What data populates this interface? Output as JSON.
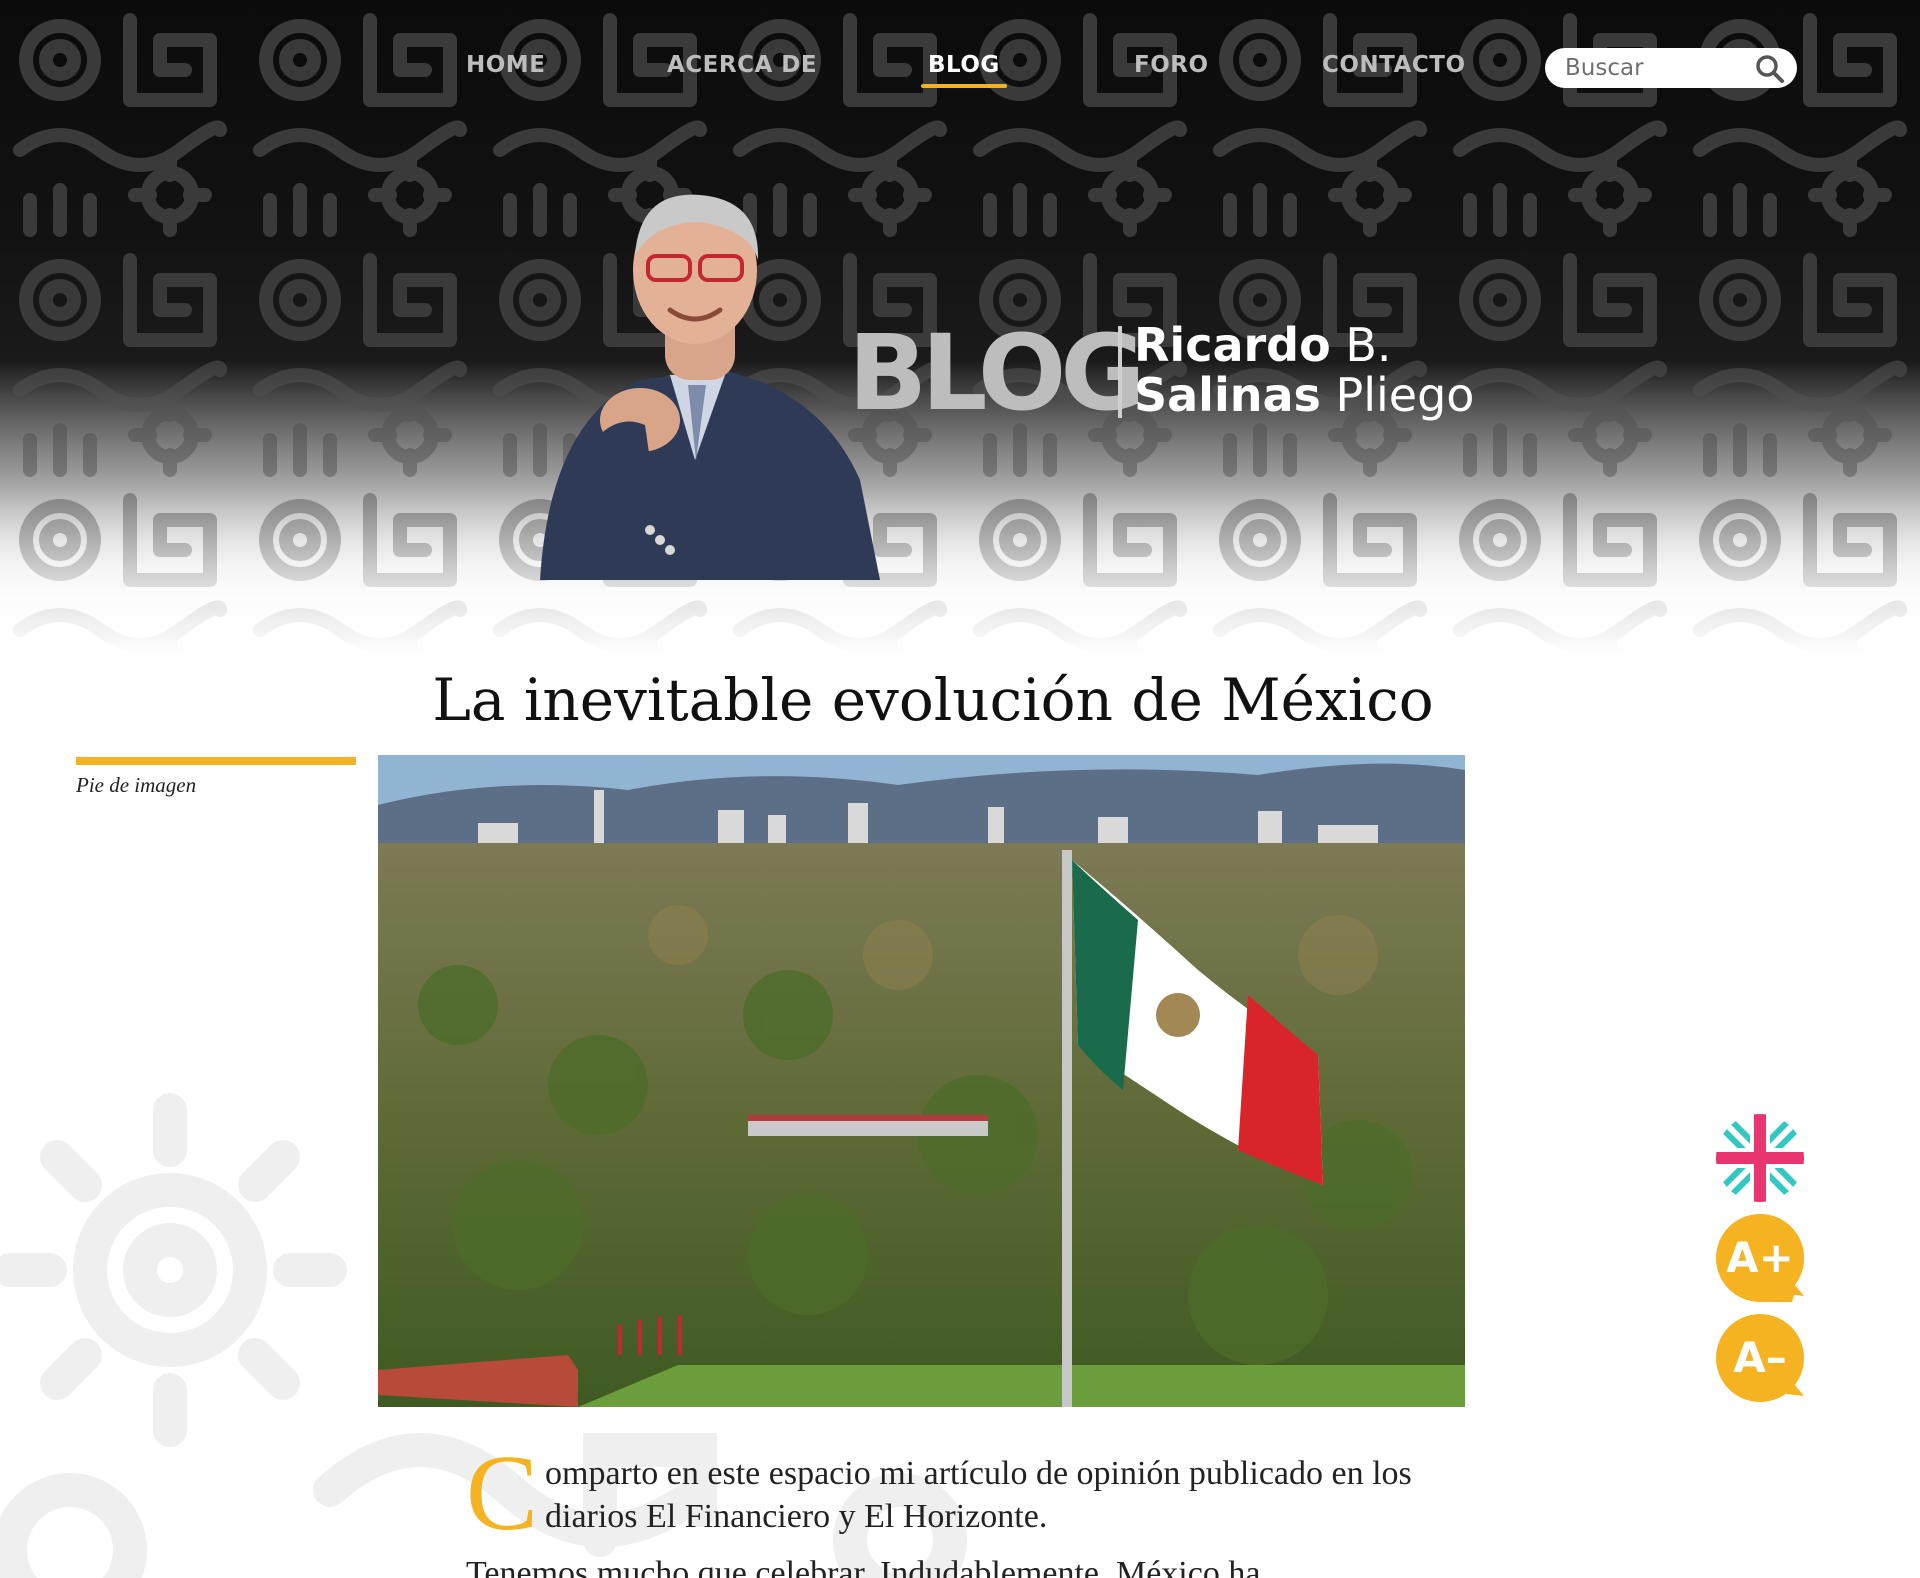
{
  "nav": {
    "items": [
      {
        "label": "HOME"
      },
      {
        "label": "ACERCA DE"
      },
      {
        "label": "BLOG"
      },
      {
        "label": "FORO"
      },
      {
        "label": "CONTACTO"
      }
    ],
    "active": "BLOG",
    "search_placeholder": "Buscar"
  },
  "logo": {
    "blog": "BLOG",
    "name_bold_1": "Ricardo",
    "name_light_1": " B.",
    "name_bold_2": "Salinas",
    "name_light_2": " Pliego"
  },
  "article": {
    "title": "La inevitable evolución de México",
    "caption": "Pie de imagen",
    "drop_cap": "C",
    "intro": "omparto en este espacio mi artículo de opinión publicado en los diarios El Financiero y El Horizonte.",
    "second_paragraph": "Tenemos mucho que celebrar. Indudablemente, México ha"
  },
  "floating_buttons": {
    "language": "uk-flag-icon",
    "increase_font": "A+",
    "decrease_font": "A–"
  },
  "colors": {
    "accent": "#f5b321",
    "hero_bg": "#0b0b0b",
    "nav_text": "#bdbdbd",
    "nav_active": "#ffffff",
    "flag_pink": "#e8356f",
    "flag_teal": "#33c7c4"
  }
}
